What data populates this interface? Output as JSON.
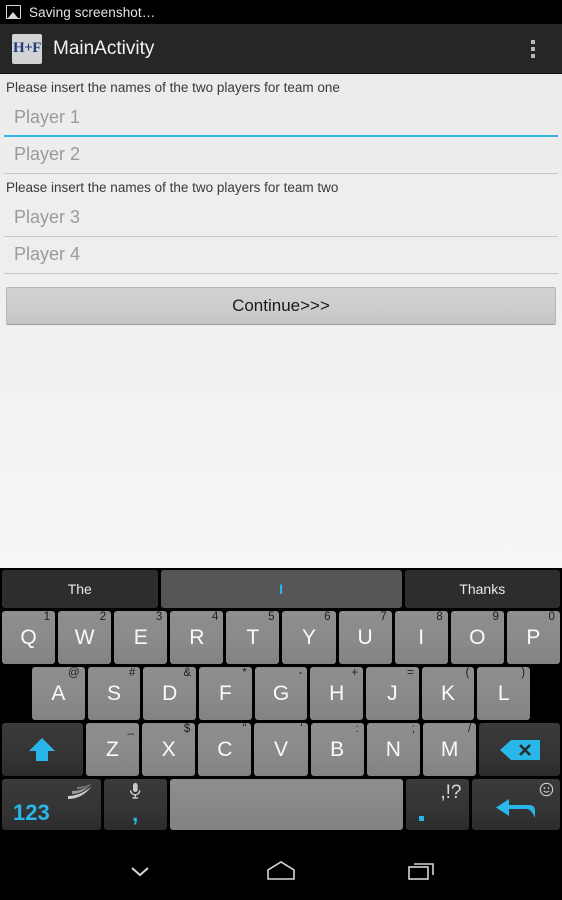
{
  "status_bar": {
    "icon": "image-icon",
    "text": "Saving screenshot…"
  },
  "action_bar": {
    "app_icon_text": "H+F",
    "title": "MainActivity",
    "overflow_icon": "overflow-menu-icon"
  },
  "form": {
    "team_one_label": "Please insert the names of the two players for team one",
    "team_two_label": "Please insert the names of the two players for team two",
    "fields": [
      {
        "name": "player-1",
        "placeholder": "Player 1",
        "value": "",
        "focused": true
      },
      {
        "name": "player-2",
        "placeholder": "Player 2",
        "value": "",
        "focused": false
      },
      {
        "name": "player-3",
        "placeholder": "Player 3",
        "value": "",
        "focused": false
      },
      {
        "name": "player-4",
        "placeholder": "Player 4",
        "value": "",
        "focused": false
      }
    ],
    "continue_label": "Continue>>>"
  },
  "keyboard": {
    "suggestions": [
      {
        "label": "The",
        "selected": false
      },
      {
        "label": "I",
        "selected": true
      },
      {
        "label": "Thanks",
        "selected": false
      }
    ],
    "row1": [
      {
        "key": "Q",
        "hint": "1"
      },
      {
        "key": "W",
        "hint": "2"
      },
      {
        "key": "E",
        "hint": "3"
      },
      {
        "key": "R",
        "hint": "4"
      },
      {
        "key": "T",
        "hint": "5"
      },
      {
        "key": "Y",
        "hint": "6"
      },
      {
        "key": "U",
        "hint": "7"
      },
      {
        "key": "I",
        "hint": "8"
      },
      {
        "key": "O",
        "hint": "9"
      },
      {
        "key": "P",
        "hint": "0"
      }
    ],
    "row2": [
      {
        "key": "A",
        "hint": "@"
      },
      {
        "key": "S",
        "hint": "#"
      },
      {
        "key": "D",
        "hint": "&"
      },
      {
        "key": "F",
        "hint": "*"
      },
      {
        "key": "G",
        "hint": "-"
      },
      {
        "key": "H",
        "hint": "+"
      },
      {
        "key": "J",
        "hint": "="
      },
      {
        "key": "K",
        "hint": "("
      },
      {
        "key": "L",
        "hint": ")"
      }
    ],
    "row3": [
      {
        "key": "Z",
        "hint": "_"
      },
      {
        "key": "X",
        "hint": "$"
      },
      {
        "key": "C",
        "hint": "\""
      },
      {
        "key": "V",
        "hint": "'"
      },
      {
        "key": "B",
        "hint": ":"
      },
      {
        "key": "N",
        "hint": ";"
      },
      {
        "key": "M",
        "hint": "/"
      }
    ],
    "shift_icon": "shift-icon",
    "backspace_icon": "backspace-icon",
    "numeric_label": "123",
    "swipe_icon": "swipe-logo-icon",
    "comma_label": ",",
    "mic_icon": "microphone-icon",
    "space_label": "",
    "period_label": ".",
    "period_hint": ",!?",
    "enter_icon": "enter-icon",
    "emoji_icon": "smiley-icon",
    "accent_color": "#29b6e8",
    "key_color": "#8a8a8a"
  },
  "nav_bar": {
    "back_icon": "hide-keyboard-chevron-icon",
    "home_icon": "home-icon",
    "recents_icon": "recents-icon"
  }
}
